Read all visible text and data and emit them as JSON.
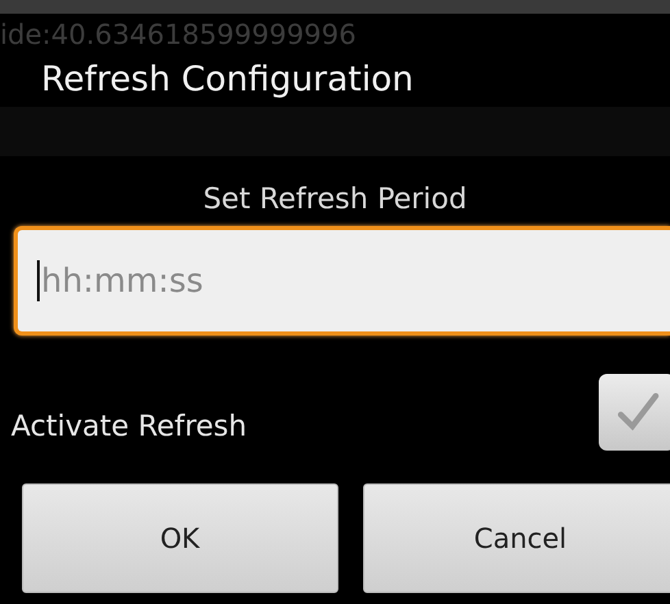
{
  "background": {
    "coordinate_line": "ide:40.634618599999996"
  },
  "dialog": {
    "title": "Refresh Configuration",
    "prompt": "Set Refresh Period",
    "period_field": {
      "placeholder": "hh:mm:ss",
      "focused": true
    },
    "activate_refresh": {
      "label": "Activate Refresh",
      "checked": true
    },
    "buttons": [
      {
        "label": "OK"
      },
      {
        "label": "Cancel"
      }
    ]
  }
}
